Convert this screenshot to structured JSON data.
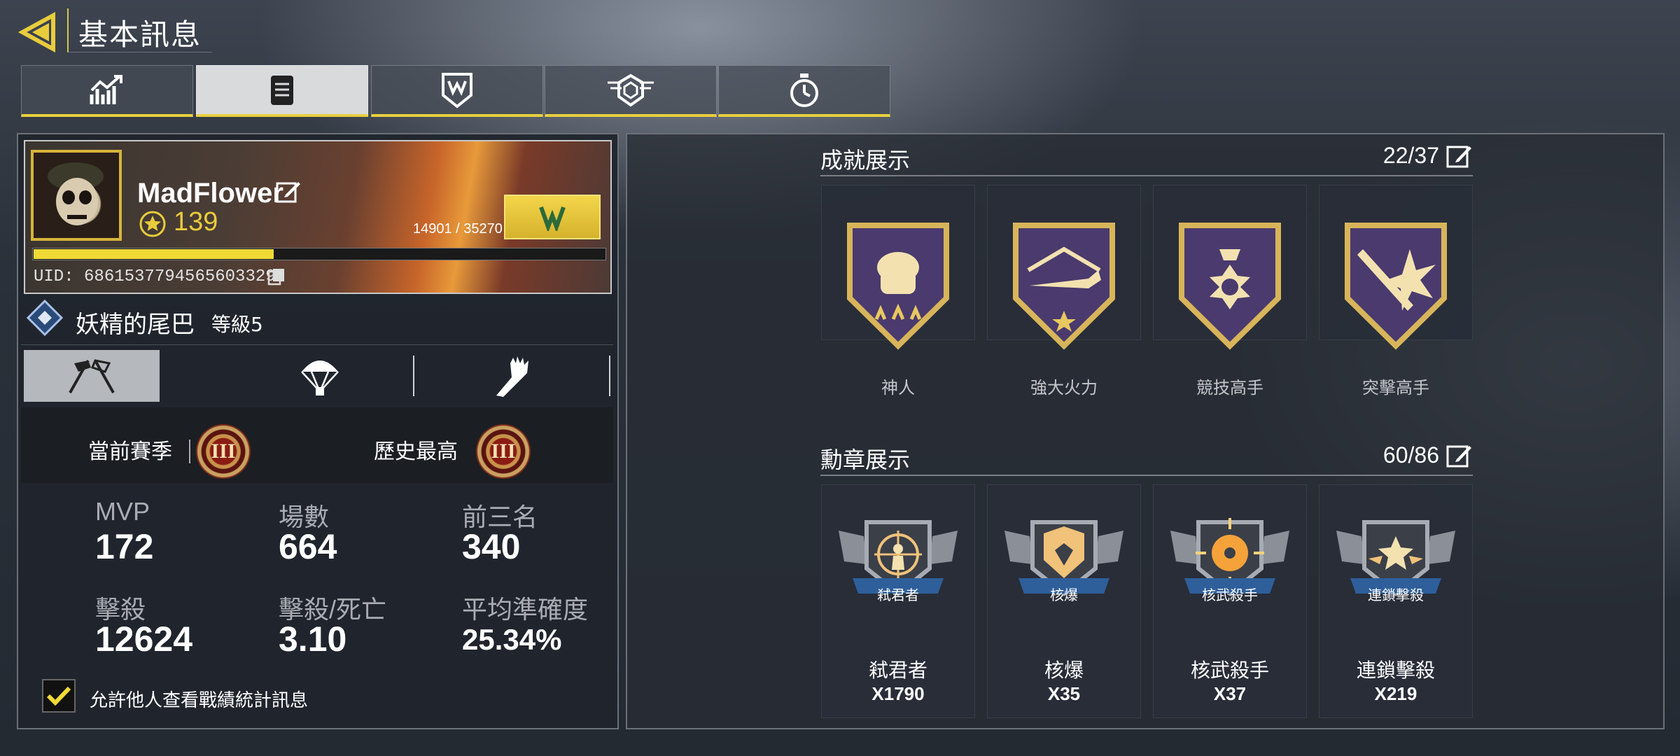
{
  "header": {
    "title": "基本訊息",
    "back_icon": "back-arrow-icon"
  },
  "tabs": [
    {
      "icon": "stats-chart-icon",
      "active": false
    },
    {
      "icon": "document-icon",
      "active": true
    },
    {
      "icon": "shield-emblem-icon",
      "active": false
    },
    {
      "icon": "winged-badge-icon",
      "active": false
    },
    {
      "icon": "stopwatch-icon",
      "active": false
    }
  ],
  "profile": {
    "username": "MadFlower",
    "level": "139",
    "xp": "14901 / 35270",
    "xp_progress": 0.42,
    "uid": "UID: 6861537794565603329",
    "clan_name": "妖精的尾巴",
    "clan_level": "等級5",
    "accent_color": "#f0d935"
  },
  "modes": [
    {
      "icon": "multiplayer-flags-icon",
      "active": true
    },
    {
      "icon": "parachute-icon",
      "active": false
    },
    {
      "icon": "zombie-hand-icon",
      "active": false
    }
  ],
  "season": {
    "current_label": "當前賽季",
    "current_rank": "III",
    "best_label": "歷史最高",
    "best_rank": "III"
  },
  "stats": [
    {
      "label": "MVP",
      "value": "172"
    },
    {
      "label": "場數",
      "value": "664"
    },
    {
      "label": "前三名",
      "value": "340"
    },
    {
      "label": "擊殺",
      "value": "12624"
    },
    {
      "label": "擊殺/死亡",
      "value": "3.10"
    },
    {
      "label": "平均準確度",
      "value": "25.34%"
    }
  ],
  "privacy": {
    "label": "允許他人查看戰績統計訊息",
    "checked": true
  },
  "achievements": {
    "title": "成就展示",
    "count": "22/37",
    "items": [
      {
        "label": "神人",
        "icon": "soldier-helmet-shield-icon"
      },
      {
        "label": "強大火力",
        "icon": "aircraft-shield-icon"
      },
      {
        "label": "競技高手",
        "icon": "cross-medal-shield-icon"
      },
      {
        "label": "突擊高手",
        "icon": "rifle-shield-icon"
      }
    ]
  },
  "medals": {
    "title": "勳章展示",
    "count": "60/86",
    "items": [
      {
        "badge": "弒君者",
        "label": "弒君者",
        "count": "X1790",
        "icon": "crosshair-medal-icon"
      },
      {
        "badge": "核爆",
        "label": "核爆",
        "count": "X35",
        "icon": "nuke-medal-icon"
      },
      {
        "badge": "核武殺手",
        "label": "核武殺手",
        "count": "X37",
        "icon": "radiation-medal-icon"
      },
      {
        "badge": "連鎖擊殺",
        "label": "連鎖擊殺",
        "count": "X219",
        "icon": "star-wings-medal-icon"
      }
    ]
  }
}
